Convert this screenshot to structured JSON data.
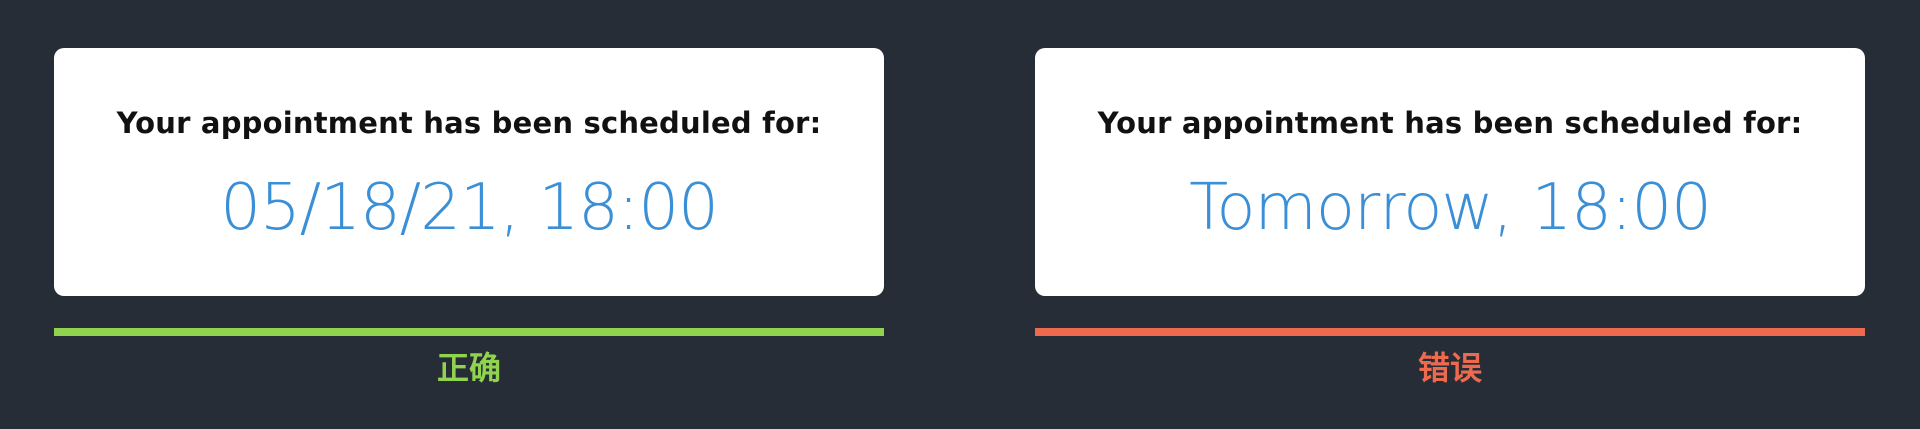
{
  "colors": {
    "background": "#272d36",
    "card": "#ffffff",
    "heading_text": "#111111",
    "value_text": "#3a8fd6",
    "correct": "#8fd34f",
    "wrong": "#ee6a4e"
  },
  "examples": [
    {
      "heading": "Your appointment has been scheduled for:",
      "value": "05/18/21, 18:00",
      "verdict": "正确"
    },
    {
      "heading": "Your appointment has been scheduled for:",
      "value": "Tomorrow, 18:00",
      "verdict": "错误"
    }
  ]
}
